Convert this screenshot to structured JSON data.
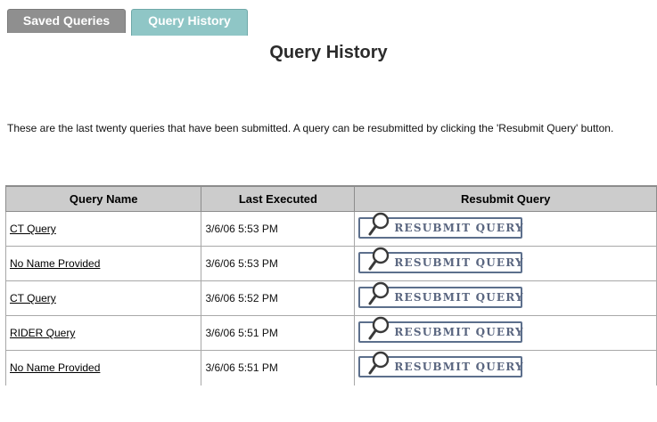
{
  "tabs": [
    {
      "label": "Saved Queries",
      "active": false
    },
    {
      "label": "Query History",
      "active": true
    }
  ],
  "page_title": "Query History",
  "intro_text": "These are the last twenty queries that have been submitted. A query can be resubmitted by clicking the 'Resubmit Query' button.",
  "table": {
    "headers": [
      "Query Name",
      "Last Executed",
      "Resubmit Query"
    ],
    "rows": [
      {
        "name": "CT Query",
        "last_executed": "3/6/06 5:53 PM",
        "button_label": "RESUBMIT QUERY"
      },
      {
        "name": "No Name Provided",
        "last_executed": "3/6/06 5:53 PM",
        "button_label": "RESUBMIT QUERY"
      },
      {
        "name": "CT Query",
        "last_executed": "3/6/06 5:52 PM",
        "button_label": "RESUBMIT QUERY"
      },
      {
        "name": "RIDER Query",
        "last_executed": "3/6/06 5:51 PM",
        "button_label": "RESUBMIT QUERY"
      },
      {
        "name": "No Name Provided",
        "last_executed": "3/6/06 5:51 PM",
        "button_label": "RESUBMIT QUERY"
      }
    ]
  },
  "colors": {
    "tab_inactive": "#8f8f8f",
    "tab_active": "#8fc6c6",
    "header_bg": "#cccccc",
    "button_border": "#5c6f8c"
  },
  "icons": {
    "resubmit": "magnifier-icon"
  }
}
